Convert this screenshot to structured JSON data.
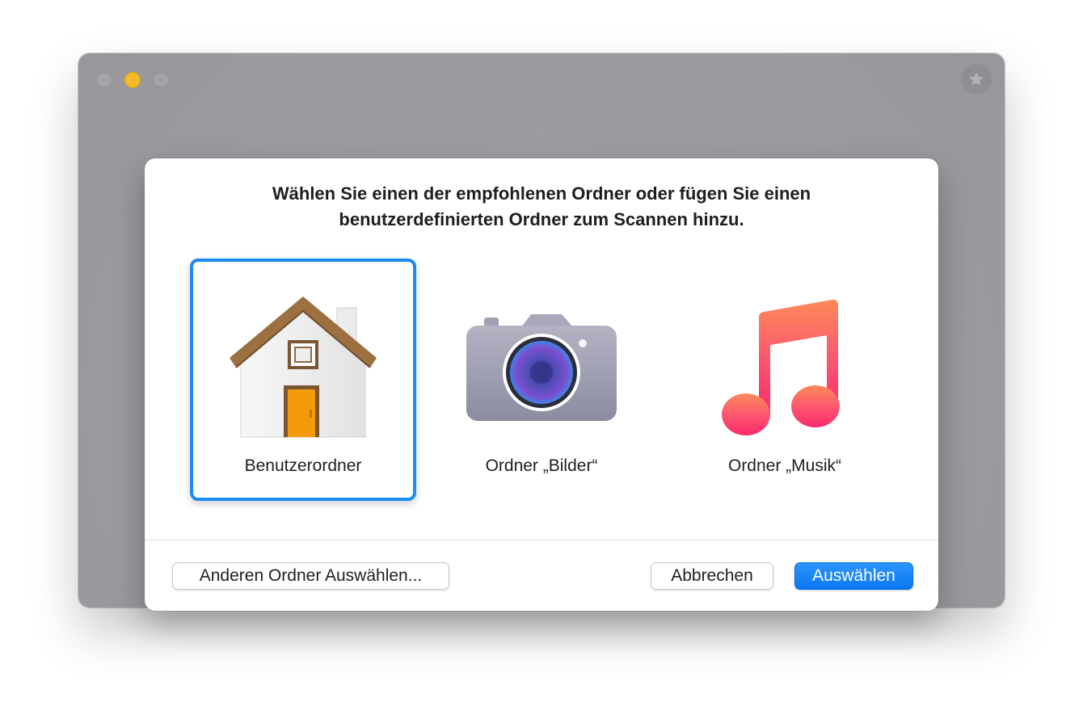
{
  "window": {
    "traffic_lights": [
      "close",
      "minimize",
      "zoom"
    ],
    "star_icon": "star-icon",
    "colors": {
      "minimize": "#f7b828",
      "inactive": "#a4a4a8"
    }
  },
  "dialog": {
    "title_line1": "Wählen Sie einen der empfohlenen Ordner oder fügen Sie einen",
    "title_line2": "benutzerdefinierten Ordner zum Scannen hinzu.",
    "choices": [
      {
        "label": "Benutzerordner",
        "icon": "home-folder-icon",
        "selected": true
      },
      {
        "label": "Ordner „Bilder“",
        "icon": "camera-icon",
        "selected": false
      },
      {
        "label": "Ordner „Musik“",
        "icon": "music-note-icon",
        "selected": false
      }
    ],
    "buttons": {
      "other": "Anderen Ordner Auswählen...",
      "cancel": "Abbrechen",
      "select": "Auswählen"
    },
    "accent_color": "#1b8df2"
  }
}
